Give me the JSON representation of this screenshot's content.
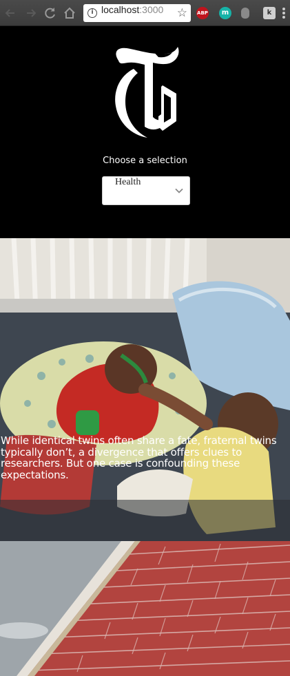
{
  "browser": {
    "url_host": "localhost",
    "url_port": ":3000",
    "extensions": {
      "abp_label": "ABP",
      "m_label": "m",
      "k_label": "k"
    },
    "icons": [
      "back-icon",
      "forward-icon",
      "reload-icon",
      "home-icon",
      "info-icon",
      "star-icon",
      "menu-icon"
    ]
  },
  "header": {
    "choose_label": "Choose a selection",
    "section_select": {
      "value": "Health"
    }
  },
  "stories": [
    {
      "caption": "While identical twins often share a fate, fraternal twins typically don’t, a divergence that offers clues to researchers. But one case is confounding these expectations."
    }
  ],
  "colors": {
    "page_background": "#000000",
    "chrome": "#3c3c3c",
    "select_background": "#ffffff",
    "caption_text": "#ffffff"
  }
}
